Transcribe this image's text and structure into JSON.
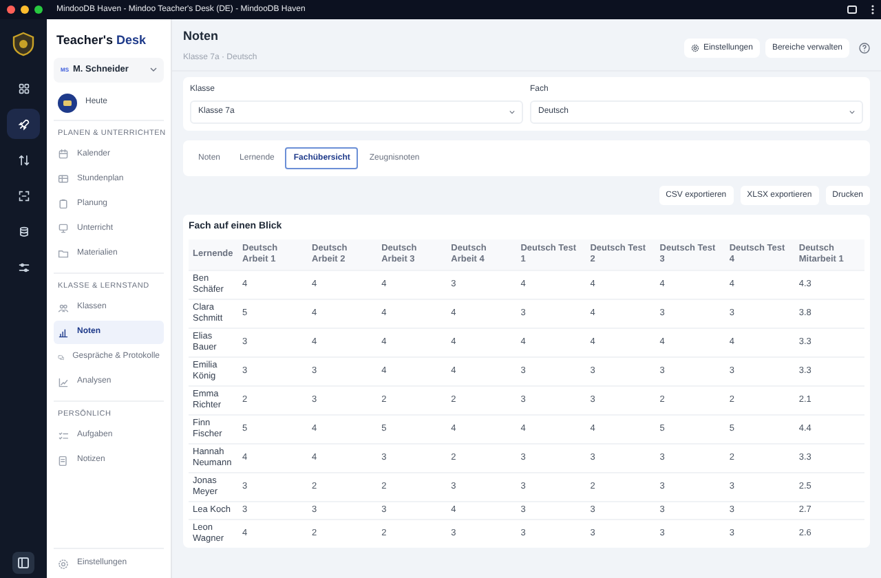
{
  "window": {
    "title": "MindooDB Haven - Mindoo Teacher's Desk (DE) - MindooDB Haven"
  },
  "rail": {
    "items": [
      {
        "kind": "grid",
        "selected": false
      },
      {
        "kind": "rocket",
        "selected": true
      },
      {
        "kind": "swap",
        "selected": false
      },
      {
        "kind": "scan",
        "selected": false
      },
      {
        "kind": "database",
        "selected": false
      },
      {
        "kind": "sliders",
        "selected": false
      }
    ]
  },
  "sidebar": {
    "brand": {
      "part_1": "Teacher's",
      "part_2": "Desk"
    },
    "user": {
      "initials": "MS",
      "name": "M. Schneider"
    },
    "today": "Heute",
    "sections": [
      {
        "heading": "PLANEN & UNTERRICHTEN",
        "items": [
          {
            "label": "Kalender",
            "kind": "calendar",
            "selected": false
          },
          {
            "label": "Stundenplan",
            "kind": "table",
            "selected": false
          },
          {
            "label": "Planung",
            "kind": "clipboard",
            "selected": false
          },
          {
            "label": "Unterricht",
            "kind": "monitor",
            "selected": false
          },
          {
            "label": "Materialien",
            "kind": "folder",
            "selected": false
          }
        ]
      },
      {
        "heading": "KLASSE & LERNSTAND",
        "items": [
          {
            "label": "Klassen",
            "kind": "people",
            "selected": false
          },
          {
            "label": "Noten",
            "kind": "chart",
            "selected": true
          },
          {
            "label": "Gespräche & Protokolle",
            "kind": "chat",
            "selected": false
          },
          {
            "label": "Analysen",
            "kind": "trend",
            "selected": false
          }
        ]
      },
      {
        "heading": "PERSÖNLICH",
        "items": [
          {
            "label": "Aufgaben",
            "kind": "list",
            "selected": false
          },
          {
            "label": "Notizen",
            "kind": "note",
            "selected": false
          }
        ]
      }
    ],
    "footer": "Einstellungen"
  },
  "header": {
    "title": "Noten",
    "subtitle": "Klasse 7a · Deutsch",
    "settings_button": "Einstellungen",
    "manage_button": "Bereiche verwalten"
  },
  "filters": [
    {
      "label": "Klasse",
      "value": "Klasse 7a"
    },
    {
      "label": "Fach",
      "value": "Deutsch"
    }
  ],
  "tabs": [
    {
      "label": "Noten",
      "selected": false
    },
    {
      "label": "Lernende",
      "selected": false
    },
    {
      "label": "Fachübersicht",
      "selected": true
    },
    {
      "label": "Zeugnisnoten",
      "selected": false
    }
  ],
  "actions": [
    "CSV exportieren",
    "XLSX exportieren",
    "Drucken"
  ],
  "table": {
    "title": "Fach auf einen Blick",
    "columns": [
      "Lernende",
      "Deutsch Arbeit 1",
      "Deutsch Arbeit 2",
      "Deutsch Arbeit 3",
      "Deutsch Arbeit 4",
      "Deutsch Test 1",
      "Deutsch Test 2",
      "Deutsch Test 3",
      "Deutsch Test 4",
      "Deutsch Mitarbeit 1"
    ],
    "rows": [
      {
        "cells": [
          "Ben Schäfer",
          "4",
          "4",
          "4",
          "3",
          "4",
          "4",
          "4",
          "4",
          "4.3"
        ]
      },
      {
        "cells": [
          "Clara Schmitt",
          "5",
          "4",
          "4",
          "4",
          "3",
          "4",
          "3",
          "3",
          "3.8"
        ]
      },
      {
        "cells": [
          "Elias Bauer",
          "3",
          "4",
          "4",
          "4",
          "4",
          "4",
          "4",
          "4",
          "3.3"
        ]
      },
      {
        "cells": [
          "Emilia König",
          "3",
          "3",
          "4",
          "4",
          "3",
          "3",
          "3",
          "3",
          "3.3"
        ]
      },
      {
        "cells": [
          "Emma Richter",
          "2",
          "3",
          "2",
          "2",
          "3",
          "3",
          "2",
          "2",
          "2.1"
        ]
      },
      {
        "cells": [
          "Finn Fischer",
          "5",
          "4",
          "5",
          "4",
          "4",
          "4",
          "5",
          "5",
          "4.4"
        ]
      },
      {
        "cells": [
          "Hannah Neumann",
          "4",
          "4",
          "3",
          "2",
          "3",
          "3",
          "3",
          "2",
          "3.3"
        ]
      },
      {
        "cells": [
          "Jonas Meyer",
          "3",
          "2",
          "2",
          "3",
          "3",
          "2",
          "3",
          "3",
          "2.5"
        ]
      },
      {
        "cells": [
          "Lea Koch",
          "3",
          "3",
          "3",
          "4",
          "3",
          "3",
          "3",
          "3",
          "2.7"
        ]
      },
      {
        "cells": [
          "Leon Wagner",
          "4",
          "2",
          "2",
          "3",
          "3",
          "3",
          "3",
          "3",
          "2.6"
        ]
      }
    ]
  }
}
